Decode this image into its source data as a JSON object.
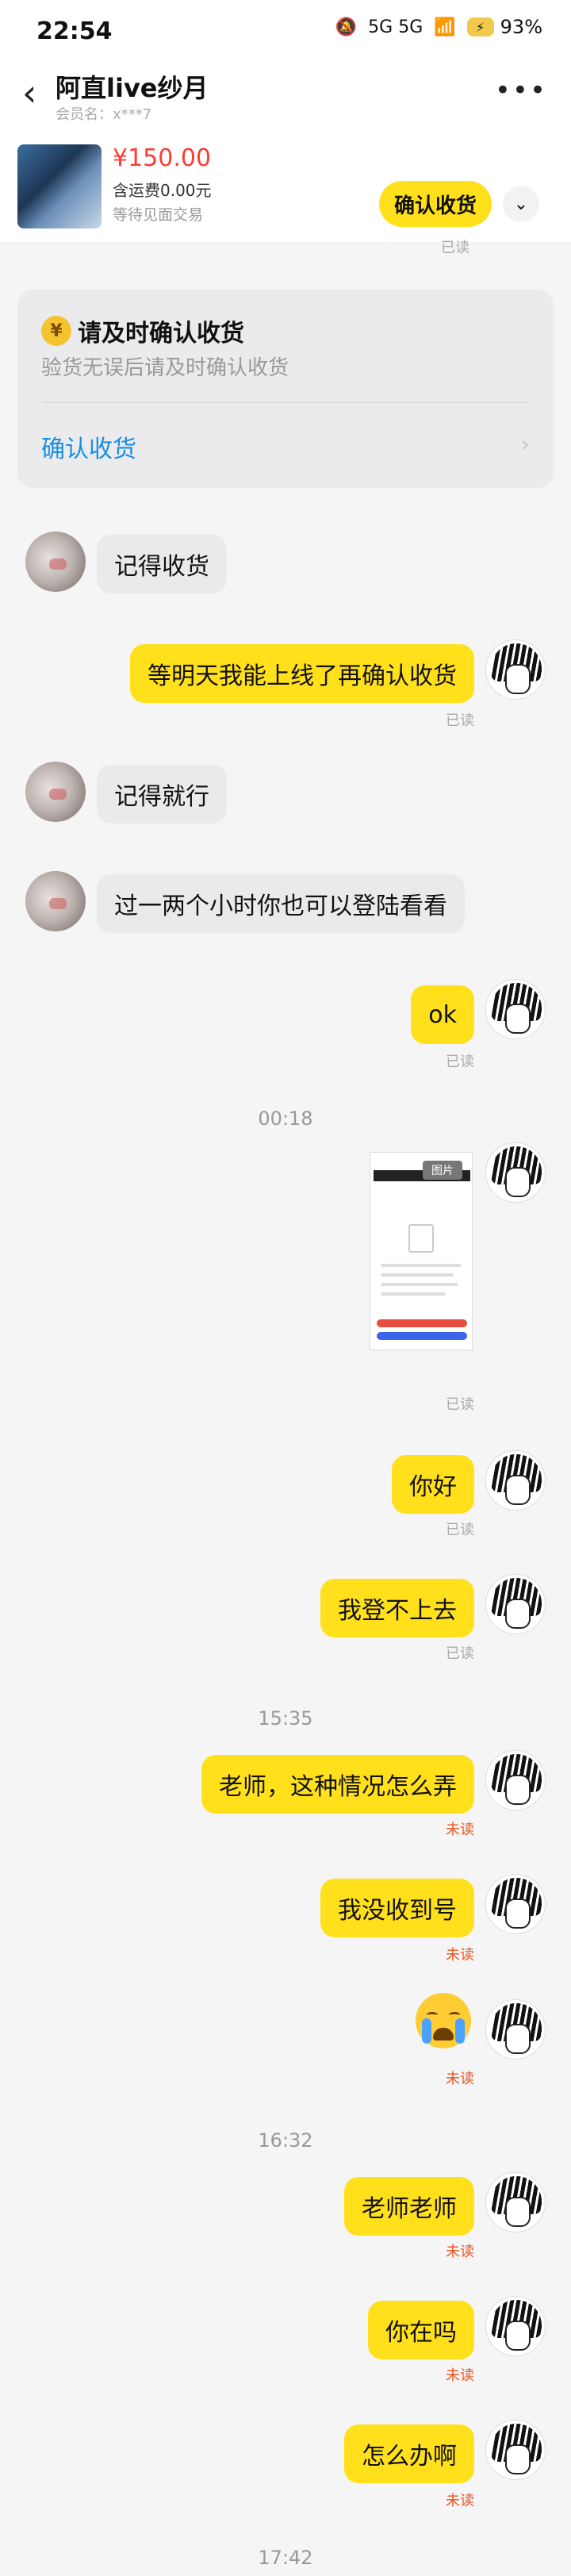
{
  "status_bar": {
    "time": "22:54",
    "network": "5G 5G",
    "battery": "93%"
  },
  "header": {
    "title": "阿直live纱月",
    "member": "会员名：x***7"
  },
  "product": {
    "price": "¥150.00",
    "shipping": "含运费0.00元",
    "status": "等待见面交易",
    "confirm_button": "确认收货"
  },
  "top_read": "已读",
  "card": {
    "title": "请及时确认收货",
    "desc": "验货无误后请及时确认收货",
    "link": "确认收货"
  },
  "messages": [
    {
      "text": "记得收货"
    },
    {
      "text": "等明天我能上线了再确认收货",
      "status": "已读"
    },
    {
      "text": "记得就行"
    },
    {
      "text": "过一两个小时你也可以登陆看看"
    },
    {
      "text": "ok",
      "status": "已读"
    },
    {
      "time": "00:18"
    },
    {
      "image_tag": "图片",
      "status": "已读"
    },
    {
      "text": "你好",
      "status": "已读"
    },
    {
      "text": "我登不上去",
      "status": "已读"
    },
    {
      "time": "15:35"
    },
    {
      "text": "老师，这种情况怎么弄",
      "status": "未读"
    },
    {
      "text": "我没收到号",
      "status": "未读"
    },
    {
      "emoji": "loudly-crying",
      "status": "未读"
    },
    {
      "time": "16:32"
    },
    {
      "text": "老师老师",
      "status": "未读"
    },
    {
      "text": "你在吗",
      "status": "未读"
    },
    {
      "text": "怎么办啊",
      "status": "未读"
    },
    {
      "time": "17:42"
    }
  ]
}
